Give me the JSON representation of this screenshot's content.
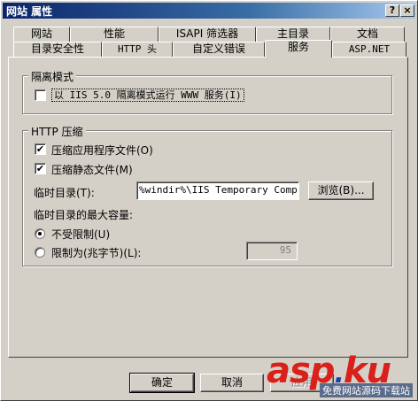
{
  "window": {
    "title": "网站 属性",
    "help_glyph": "?",
    "close_glyph": "×"
  },
  "tabs_row_back": [
    {
      "label": "网站"
    },
    {
      "label": "性能"
    },
    {
      "label": "ISAPI 筛选器"
    },
    {
      "label": "主目录"
    },
    {
      "label": "文档"
    }
  ],
  "tabs_row_front": [
    {
      "label": "目录安全性"
    },
    {
      "label": "HTTP 头"
    },
    {
      "label": "自定义错误"
    },
    {
      "label": "服务",
      "active": true
    },
    {
      "label": "ASP.NET"
    }
  ],
  "isolation": {
    "group_label": "隔离模式",
    "run_iis5": {
      "label": "以 IIS 5.0 隔离模式运行 WWW 服务(I)",
      "checked": false
    }
  },
  "compression": {
    "group_label": "HTTP 压缩",
    "compress_app": {
      "label": "压缩应用程序文件(O)",
      "checked": true,
      "mark": "✔"
    },
    "compress_static": {
      "label": "压缩静态文件(M)",
      "checked": true,
      "mark": "✔"
    },
    "temp_dir_label": "临时目录(T):",
    "temp_dir_value": "%windir%\\IIS Temporary Compres",
    "browse_label": "浏览(B)...",
    "max_size_label": "临时目录的最大容量:",
    "unlimited": {
      "label": "不受限制(U)",
      "selected": true
    },
    "limit_to": {
      "label": "限制为(兆字节)(L):",
      "selected": false
    },
    "limit_value": "95"
  },
  "buttons": {
    "ok": "确定",
    "cancel": "取消",
    "apply": "应用"
  },
  "watermark": {
    "brand_left": "asp",
    "brand_right": "ku",
    "dot": ".",
    "tagline": "免费网站源码下载站"
  }
}
